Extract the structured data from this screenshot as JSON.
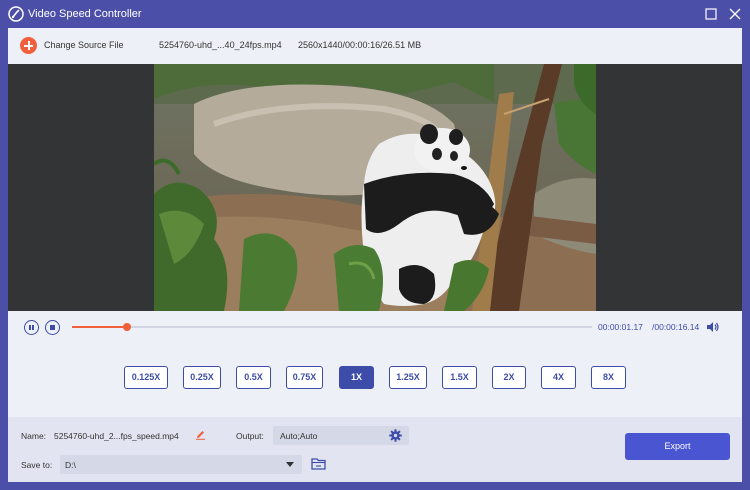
{
  "window": {
    "title": "Video Speed Controller"
  },
  "topbar": {
    "change_source_label": "Change Source File",
    "file_name": "5254760-uhd_...40_24fps.mp4",
    "file_meta": "2560x1440/00:00:16/26.51 MB"
  },
  "playback": {
    "current_time": "00:00:01.17",
    "total_time": "/00:00:16.14",
    "progress_fraction": 0.106
  },
  "speeds": {
    "selected": "1X",
    "options": [
      "0.125X",
      "0.25X",
      "0.5X",
      "0.75X",
      "1X",
      "1.25X",
      "1.5X",
      "2X",
      "4X",
      "8X"
    ]
  },
  "output": {
    "name_label": "Name:",
    "name_value": "5254760-uhd_2...fps_speed.mp4",
    "output_label": "Output:",
    "output_value": "Auto;Auto",
    "save_label": "Save to:",
    "save_value": "D:\\",
    "export_label": "Export"
  },
  "colors": {
    "title_bar": "#4b4fa8",
    "accent": "#3d4ca8",
    "progress": "#f0603c",
    "export_button": "#4a55d1"
  },
  "icons": [
    "app-logo-icon",
    "maximize-icon",
    "close-icon",
    "add-icon",
    "pause-icon",
    "stop-icon",
    "volume-icon",
    "edit-icon",
    "gear-icon",
    "chevron-down-icon",
    "folder-icon"
  ]
}
